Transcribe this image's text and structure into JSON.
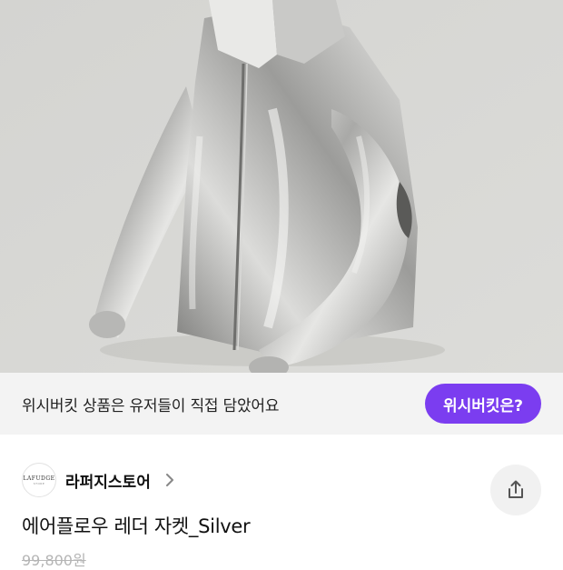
{
  "product_image": {
    "alt": "silver-metallic-jacket-photo"
  },
  "wish_banner": {
    "text": "위시버킷 상품은 유저들이 직접 담았어요",
    "button_label": "위시버킷은?",
    "button_color": "#7b3df0"
  },
  "store": {
    "logo_text": "LAFUDGE",
    "logo_subtext": "STORE",
    "name": "라퍼지스토어"
  },
  "product": {
    "title": "에어플로우 레더 자켓_Silver",
    "original_price": "99,800원"
  },
  "icons": {
    "store_chevron": "chevron-right-icon",
    "share": "share-icon"
  }
}
